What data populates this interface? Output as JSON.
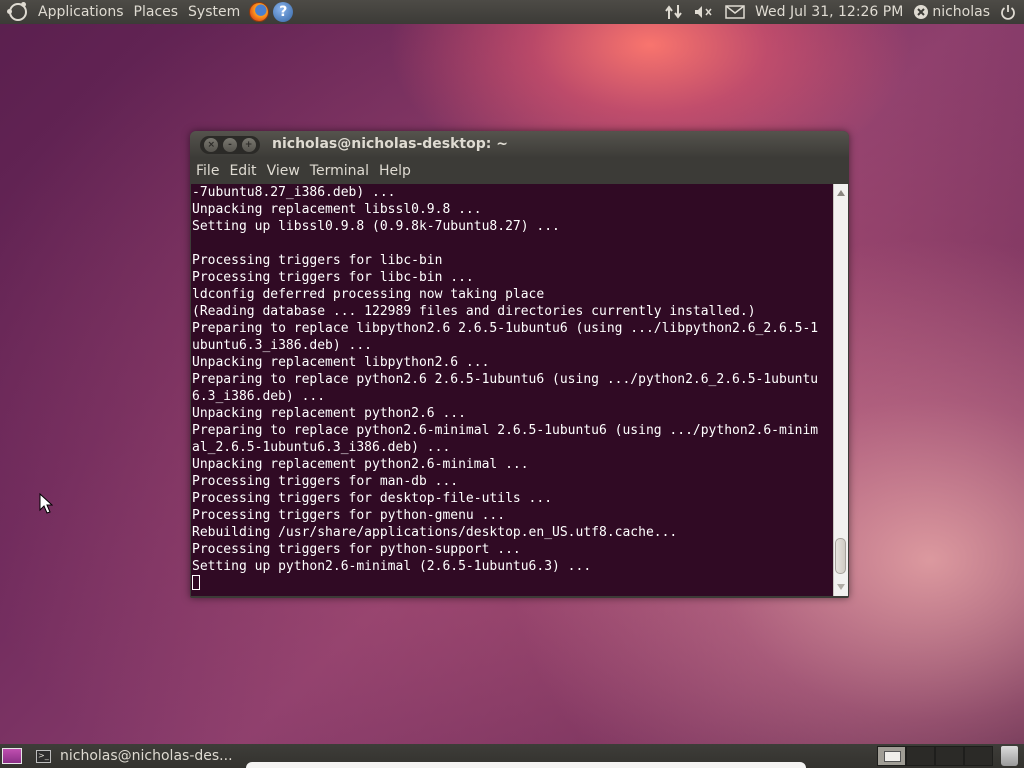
{
  "top_panel": {
    "menus": [
      "Applications",
      "Places",
      "System"
    ],
    "datetime": "Wed Jul 31, 12:26 PM",
    "user": "nicholas",
    "icons": [
      "ubuntu-logo-icon",
      "firefox-icon",
      "help-icon",
      "network-icon",
      "volume-icon",
      "mail-icon",
      "user-status-icon",
      "power-icon"
    ]
  },
  "terminal": {
    "title": "nicholas@nicholas-desktop: ~",
    "menu": [
      "File",
      "Edit",
      "View",
      "Terminal",
      "Help"
    ],
    "window_buttons": [
      "close",
      "minimize",
      "maximize"
    ],
    "lines": [
      "-7ubuntu8.27_i386.deb) ...",
      "Unpacking replacement libssl0.9.8 ...",
      "Setting up libssl0.9.8 (0.9.8k-7ubuntu8.27) ...",
      "",
      "Processing triggers for libc-bin",
      "Processing triggers for libc-bin ...",
      "ldconfig deferred processing now taking place",
      "(Reading database ... 122989 files and directories currently installed.)",
      "Preparing to replace libpython2.6 2.6.5-1ubuntu6 (using .../libpython2.6_2.6.5-1",
      "ubuntu6.3_i386.deb) ...",
      "Unpacking replacement libpython2.6 ...",
      "Preparing to replace python2.6 2.6.5-1ubuntu6 (using .../python2.6_2.6.5-1ubuntu",
      "6.3_i386.deb) ...",
      "Unpacking replacement python2.6 ...",
      "Preparing to replace python2.6-minimal 2.6.5-1ubuntu6 (using .../python2.6-minim",
      "al_2.6.5-1ubuntu6.3_i386.deb) ...",
      "Unpacking replacement python2.6-minimal ...",
      "Processing triggers for man-db ...",
      "Processing triggers for desktop-file-utils ...",
      "Processing triggers for python-gmenu ...",
      "Rebuilding /usr/share/applications/desktop.en_US.utf8.cache...",
      "Processing triggers for python-support ...",
      "Setting up python2.6-minimal (2.6.5-1ubuntu6.3) ..."
    ],
    "colors": {
      "background": "#300a24",
      "foreground": "#ffffff"
    }
  },
  "bottom_panel": {
    "task_label": "nicholas@nicholas-des...",
    "workspaces": 4,
    "icons": [
      "show-desktop-icon",
      "terminal-icon",
      "trash-icon"
    ]
  }
}
